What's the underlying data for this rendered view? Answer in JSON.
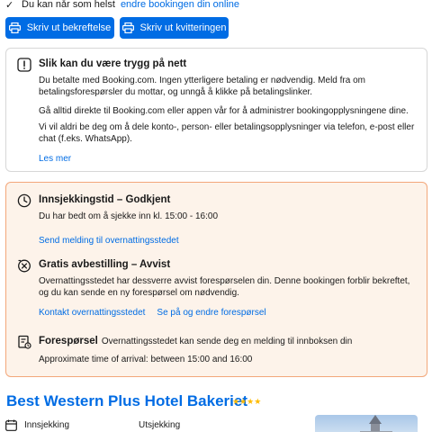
{
  "top": {
    "prefix": "Du kan når som helst",
    "link": "endre bookingen din online"
  },
  "buttons": {
    "print_confirmation": "Skriv ut bekreftelse",
    "print_receipt": "Skriv ut kvitteringen"
  },
  "safety": {
    "title": "Slik kan du være trygg på nett",
    "p1": "Du betalte med Booking.com. Ingen ytterligere betaling er nødvendig. Meld fra om betalingsforespørsler du mottar, og unngå å klikke på betalingslinker.",
    "p2": "Gå alltid direkte til Booking.com eller appen vår for å administrer bookingopplysningene dine.",
    "p3": "Vi vil aldri be deg om å dele konto-, person- eller betalingsopplysninger via telefon, e-post eller chat (f.eks. WhatsApp).",
    "more": "Les mer"
  },
  "checkin_time": {
    "title": "Innsjekkingstid – Godkjent",
    "body": "Du har bedt om å sjekke inn kl. 15:00 - 16:00",
    "link": "Send melding til overnattingsstedet"
  },
  "cancellation": {
    "title": "Gratis avbestilling – Avvist",
    "body": "Overnattingsstedet har dessverre avvist forespørselen din. Denne bookingen forblir bekreftet, og du kan sende en ny forespørsel om nødvendig.",
    "link1": "Kontakt overnattingsstedet",
    "link2": "Se på og endre forespørsel"
  },
  "request": {
    "title": "Forespørsel",
    "inline": "Overnattingsstedet kan sende deg en melding til innboksen din",
    "arrival": "Approximate time of arrival: between 15:00 and 16:00"
  },
  "hotel": {
    "name": "Best Western Plus Hotel Bakeriet",
    "stars": 4,
    "checkin_label": "Innsjekking",
    "checkout_label": "Utsjekking"
  },
  "colors": {
    "primary": "#006ce4",
    "accent_border": "#f3a77a",
    "accent_bg": "#fdf3ea",
    "star": "#febb02"
  }
}
